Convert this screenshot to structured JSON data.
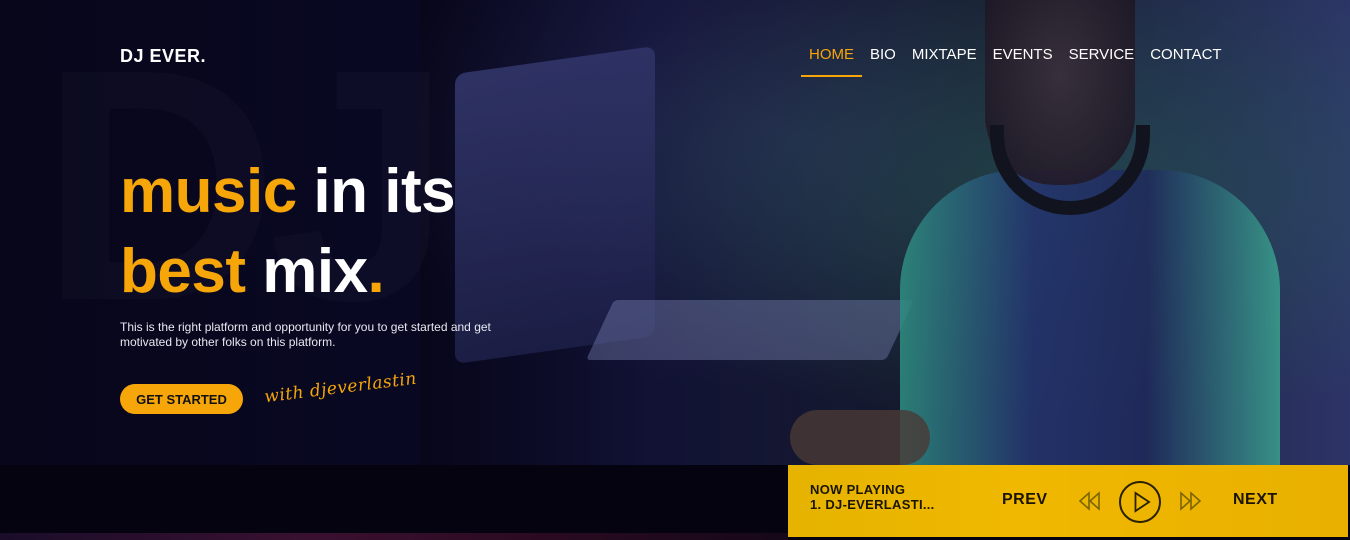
{
  "brand": {
    "logo": "DJ EVER."
  },
  "nav": {
    "items": [
      {
        "label": "HOME",
        "active": true
      },
      {
        "label": "BIO"
      },
      {
        "label": "MIXTAPE"
      },
      {
        "label": "EVENTS"
      },
      {
        "label": "SERVICE"
      },
      {
        "label": "CONTACT"
      }
    ]
  },
  "hero": {
    "line1_accent": "music",
    "line1_rest": " in its",
    "line2_accent": "best",
    "line2_rest": " mix",
    "line2_dot": ".",
    "description": "This is the right platform and opportunity for you to get started and get motivated by other folks on this platform.",
    "cta_label": "GET STARTED",
    "signature": "with djeverlastin"
  },
  "player": {
    "now_playing_label": "NOW PLAYING",
    "track": "1. DJ-EVERLASTI...",
    "prev_label": "PREV",
    "next_label": "NEXT"
  },
  "colors": {
    "accent": "#f6a609",
    "player_bg": "#f0b800",
    "background": "#05040f"
  },
  "icons": {
    "rewind": "rewind-icon",
    "play": "play-icon",
    "fast_forward": "fast-forward-icon"
  }
}
